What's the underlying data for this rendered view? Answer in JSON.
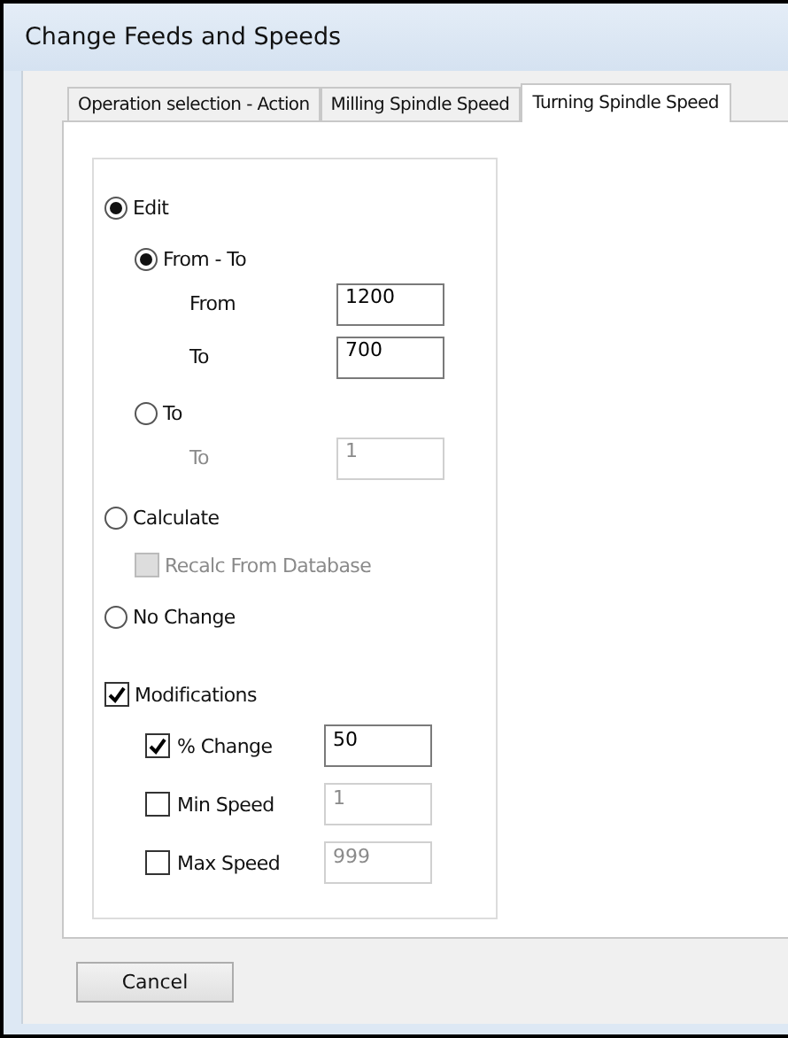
{
  "window": {
    "title": "Change Feeds and Speeds"
  },
  "tabs": [
    {
      "label": "Operation selection - Action",
      "selected": false
    },
    {
      "label": "Milling Spindle Speed",
      "selected": false
    },
    {
      "label": "Turning Spindle Speed",
      "selected": true
    }
  ],
  "options": [
    {
      "kind": "radio",
      "label": "Edit",
      "selected": true,
      "children": [
        {
          "kind": "radio",
          "label": "From - To",
          "selected": true,
          "fields": [
            {
              "label": "From",
              "value": "1200",
              "disabled": false
            },
            {
              "label": "To",
              "value": "700",
              "disabled": false
            }
          ]
        },
        {
          "kind": "radio",
          "label": "To",
          "selected": false,
          "fields": [
            {
              "label": "To",
              "value": "1",
              "disabled": true
            }
          ]
        }
      ]
    },
    {
      "kind": "radio",
      "label": "Calculate",
      "selected": false,
      "children": [
        {
          "kind": "checkbox",
          "label": "Recalc From Database",
          "checked": false,
          "disabled": true
        }
      ]
    },
    {
      "kind": "radio",
      "label": "No Change",
      "selected": false
    }
  ],
  "modifications": {
    "label": "Modifications",
    "checked": true,
    "items": [
      {
        "label": "% Change",
        "checked": true,
        "value": "50",
        "disabled": false
      },
      {
        "label": "Min Speed",
        "checked": false,
        "value": "1",
        "disabled": true
      },
      {
        "label": "Max Speed",
        "checked": false,
        "value": "999",
        "disabled": true
      }
    ]
  },
  "buttons": [
    "Cancel"
  ]
}
